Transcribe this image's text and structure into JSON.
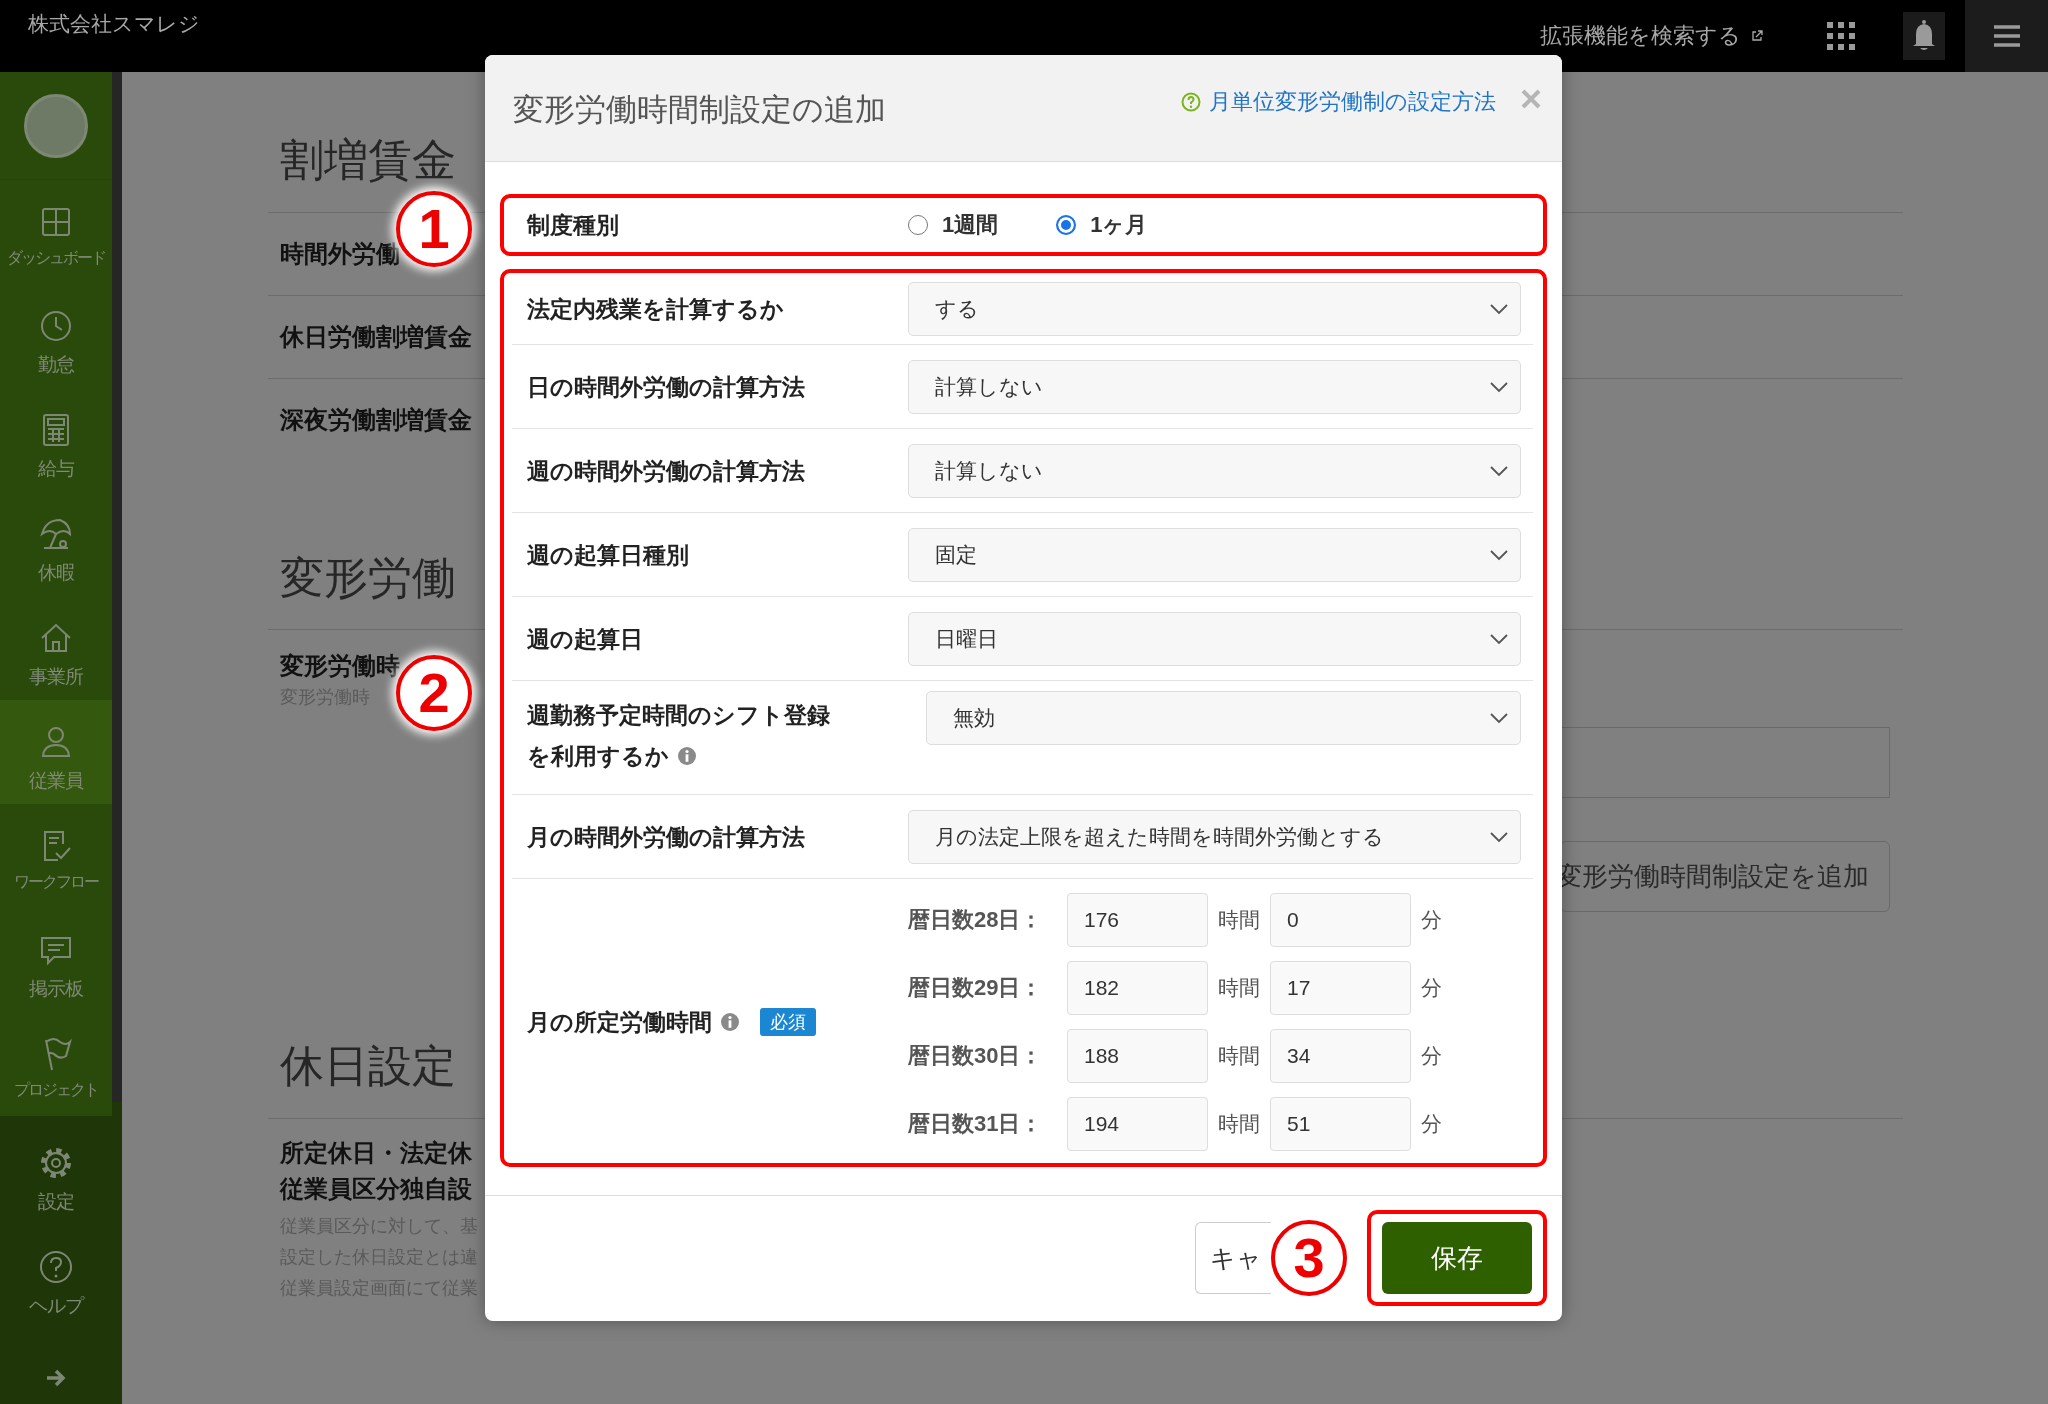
{
  "top_bar": {
    "company": "株式会社スマレジ",
    "extension_search": "拡張機能を検索する"
  },
  "sidebar": {
    "items": [
      {
        "label": "ダッシュボード",
        "kind": "dashboard",
        "selected": false
      },
      {
        "label": "勤怠",
        "kind": "clock",
        "selected": false
      },
      {
        "label": "給与",
        "kind": "calculator",
        "selected": false
      },
      {
        "label": "休暇",
        "kind": "parasol",
        "selected": false
      },
      {
        "label": "事業所",
        "kind": "home",
        "selected": false
      },
      {
        "label": "従業員",
        "kind": "person",
        "selected": true
      },
      {
        "label": "ワークフロー",
        "kind": "workflow",
        "selected": false
      },
      {
        "label": "掲示板",
        "kind": "board",
        "selected": false
      },
      {
        "label": "プロジェクト",
        "kind": "flag",
        "selected": false
      }
    ],
    "bottom_items": [
      {
        "label": "設定",
        "kind": "gear"
      },
      {
        "label": "ヘルプ",
        "kind": "help"
      }
    ]
  },
  "page": {
    "premium_section": {
      "heading": "割増賃金",
      "rows": [
        "時間外労働",
        "休日労働割増賃金",
        "深夜労働割増賃金"
      ]
    },
    "flex_section": {
      "heading": "変形労働",
      "row_title": "変形労働時",
      "row_note": "変形労働時",
      "add_button": "変形労働時間制設定を追加"
    },
    "holiday_section": {
      "heading": "休日設定",
      "rows": [
        "所定休日・法定休",
        "従業員区分独自設"
      ],
      "notes": [
        "従業員区分に対して、基",
        "設定した休日設定とは違",
        "従業員設定画面にて従業"
      ]
    }
  },
  "modal": {
    "title": "変形労働時間制設定の追加",
    "help_link": "月単位変形労働制の設定方法",
    "system_type": {
      "label": "制度種別",
      "annotation": "1",
      "options": [
        {
          "label": "1週間",
          "selected": false
        },
        {
          "label": "1ヶ月",
          "selected": true
        }
      ]
    },
    "settings": {
      "annotation": "2",
      "rows": [
        {
          "label": "法定内残業を計算するか",
          "info": false,
          "value": "する"
        },
        {
          "label": "日の時間外労働の計算方法",
          "info": false,
          "value": "計算しない"
        },
        {
          "label": "週の時間外労働の計算方法",
          "info": false,
          "value": "計算しない"
        },
        {
          "label": "週の起算日種別",
          "info": false,
          "value": "固定"
        },
        {
          "label": "週の起算日",
          "info": false,
          "value": "日曜日"
        },
        {
          "label": "週勤務予定時間のシフト登録を利用するか",
          "info": true,
          "value": "無効"
        },
        {
          "label": "月の時間外労働の計算方法",
          "info": false,
          "value": "月の法定上限を超えた時間を時間外労働とする"
        }
      ],
      "monthly_hours": {
        "label": "月の所定労働時間",
        "info": true,
        "required": "必須",
        "rows": [
          {
            "label": "暦日数28日：",
            "hours": "176",
            "hours_unit": "時間",
            "minutes": "0",
            "minutes_unit": "分"
          },
          {
            "label": "暦日数29日：",
            "hours": "182",
            "hours_unit": "時間",
            "minutes": "17",
            "minutes_unit": "分"
          },
          {
            "label": "暦日数30日：",
            "hours": "188",
            "hours_unit": "時間",
            "minutes": "34",
            "minutes_unit": "分"
          },
          {
            "label": "暦日数31日：",
            "hours": "194",
            "hours_unit": "時間",
            "minutes": "51",
            "minutes_unit": "分"
          }
        ]
      }
    },
    "footer": {
      "cancel": "キャ",
      "annotation": "3",
      "save": "保存"
    }
  }
}
